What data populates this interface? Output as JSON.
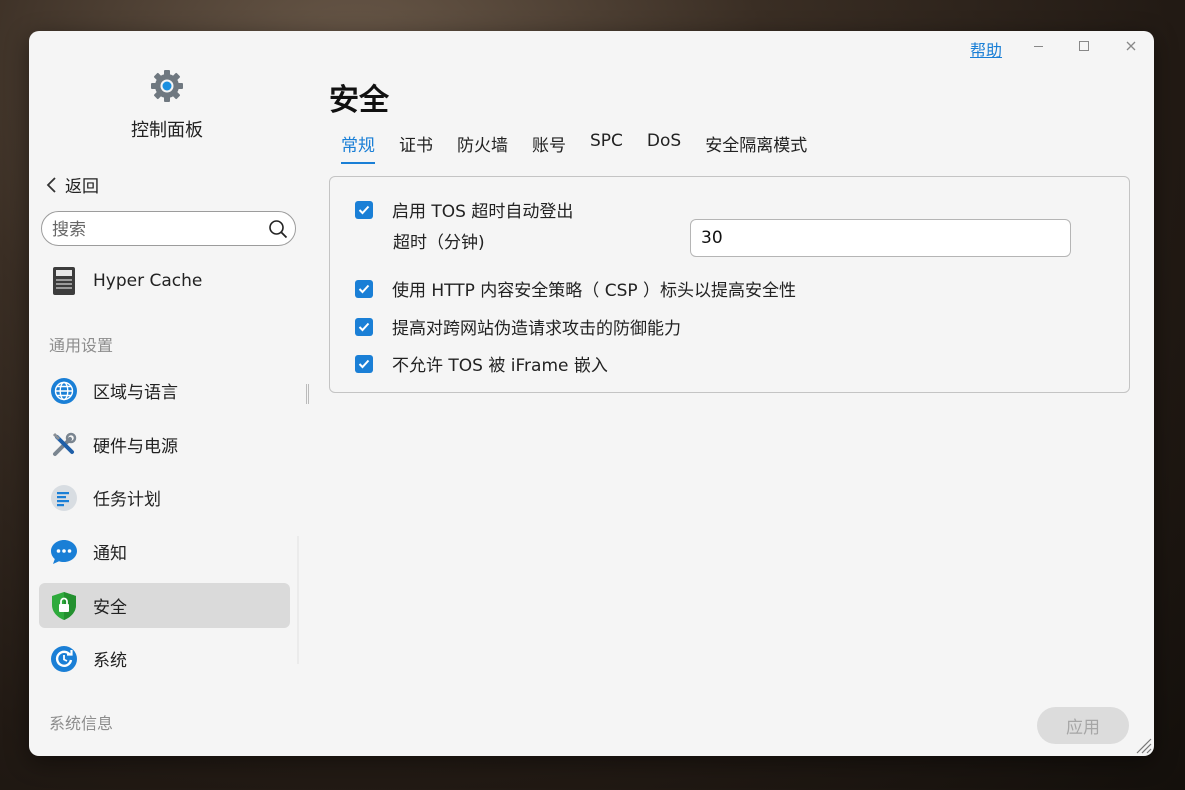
{
  "window": {
    "help_label": "帮助"
  },
  "sidebar": {
    "app_title": "控制面板",
    "back_label": "返回",
    "search_placeholder": "搜索",
    "hyper_cache_label": "Hyper Cache",
    "general_section_label": "通用设置",
    "items": [
      {
        "label": "区域与语言",
        "icon": "globe-icon"
      },
      {
        "label": "硬件与电源",
        "icon": "tools-icon"
      },
      {
        "label": "任务计划",
        "icon": "task-list-icon"
      },
      {
        "label": "通知",
        "icon": "chat-bubble-icon"
      },
      {
        "label": "安全",
        "icon": "shield-lock-icon",
        "active": true
      },
      {
        "label": "系统",
        "icon": "system-refresh-icon"
      }
    ],
    "system_info_section_label": "系统信息"
  },
  "main": {
    "title": "安全",
    "tabs": [
      "常规",
      "证书",
      "防火墙",
      "账号",
      "SPC",
      "DoS",
      "安全隔离模式"
    ],
    "active_tab": "常规",
    "options": {
      "auto_logout_label": "启用 TOS 超时自动登出",
      "timeout_label": "超时（分钟)",
      "timeout_value": "30",
      "csp_label": "使用 HTTP 内容安全策略（ CSP ）标头以提高安全性",
      "csrf_label": "提高对跨网站伪造请求攻击的防御能力",
      "iframe_label": "不允许 TOS 被 iFrame 嵌入"
    },
    "apply_label": "应用"
  },
  "colors": {
    "accent": "#1a7fd6",
    "window_bg": "#f5f5f5",
    "active_item_bg": "#dadada",
    "disabled_button_bg": "#dcdcdc"
  }
}
